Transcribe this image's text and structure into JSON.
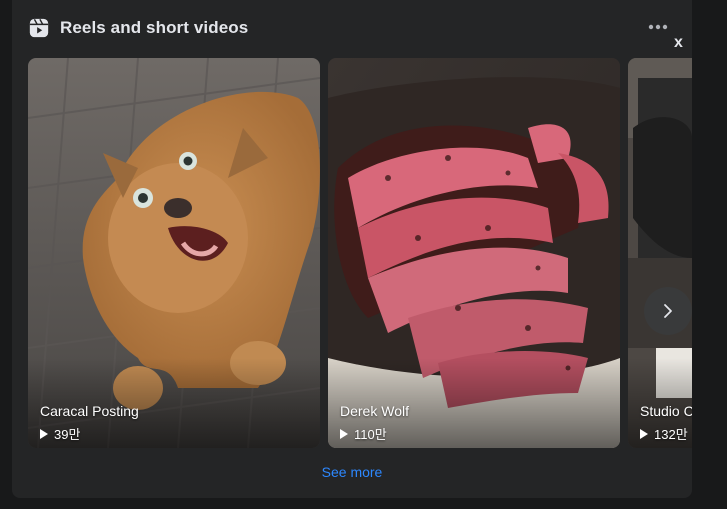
{
  "section": {
    "title": "Reels and short videos",
    "close_label": "x",
    "see_more_label": "See more",
    "icons": {
      "header": "reels-icon",
      "more": "more-options-icon",
      "next": "chevron-right-icon",
      "play": "play-icon"
    }
  },
  "reels": [
    {
      "name": "Caracal Posting",
      "views": "39만"
    },
    {
      "name": "Derek Wolf",
      "views": "110만"
    },
    {
      "name": "Studio C",
      "views": "132만"
    }
  ],
  "colors": {
    "background": "#18191a",
    "card": "#242526",
    "text_primary": "#e4e6eb",
    "link": "#2d88ff"
  }
}
